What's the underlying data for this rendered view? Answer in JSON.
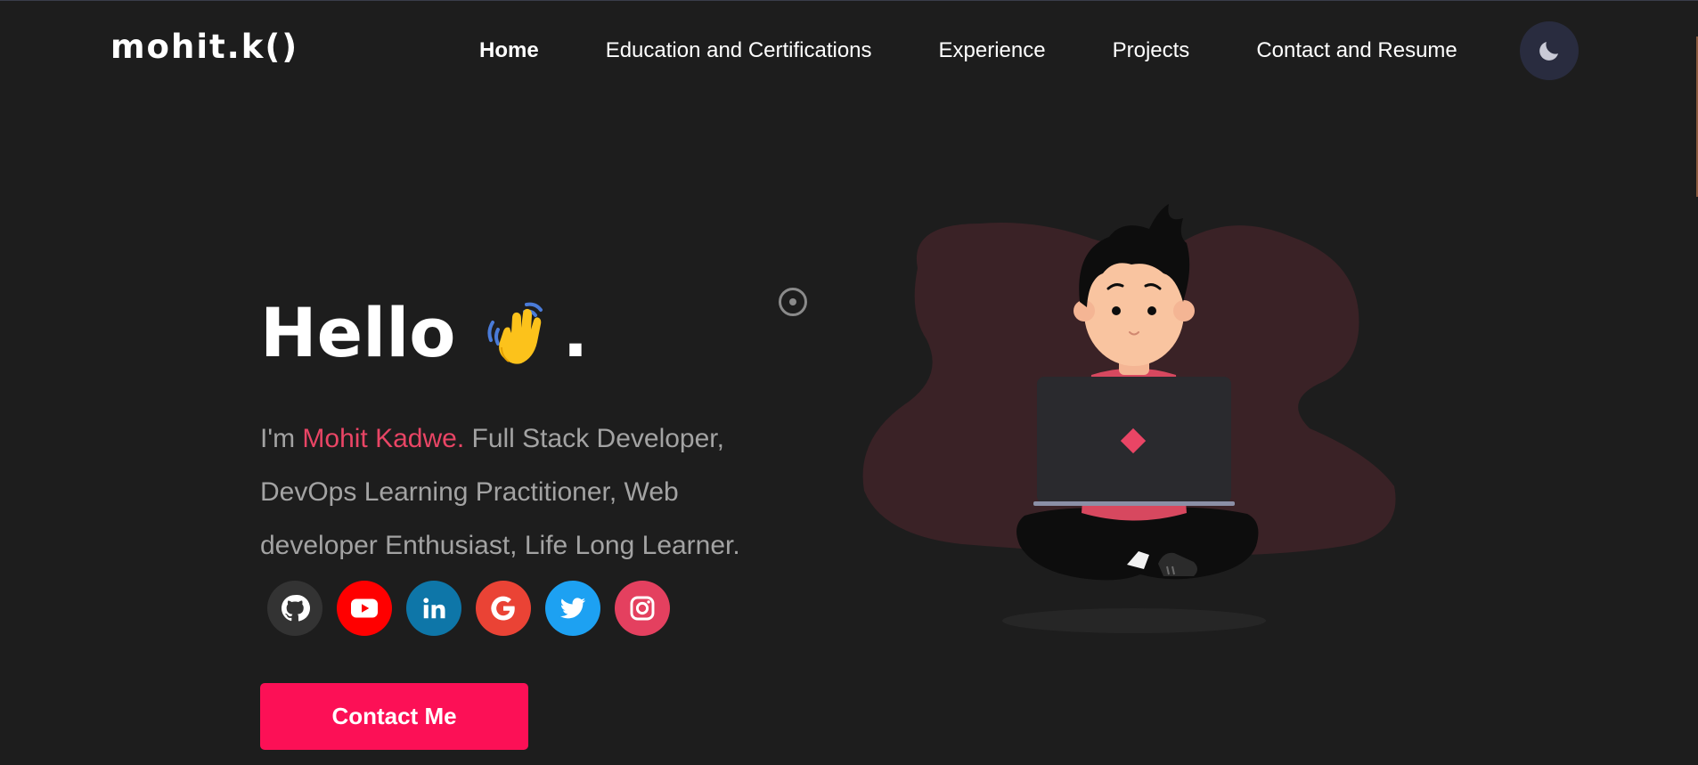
{
  "header": {
    "logo": "mohit.k()",
    "nav": [
      {
        "label": "Home",
        "active": true
      },
      {
        "label": "Education and Certifications",
        "active": false
      },
      {
        "label": "Experience",
        "active": false
      },
      {
        "label": "Projects",
        "active": false
      },
      {
        "label": "Contact and Resume",
        "active": false
      }
    ],
    "theme_toggle_icon": "moon-icon"
  },
  "hero": {
    "greeting": "Hello",
    "greeting_emoji": "waving-hand-icon",
    "greeting_end": ".",
    "intro_prefix": "I'm ",
    "intro_name": "Mohit Kadwe.",
    "intro_rest": " Full Stack Developer, DevOps Learning Practitioner, Web developer Enthusiast, Life Long Learner.",
    "socials": [
      {
        "name": "github",
        "icon": "github-icon",
        "color": "#333333"
      },
      {
        "name": "youtube",
        "icon": "youtube-icon",
        "color": "#ff0000"
      },
      {
        "name": "linkedin",
        "icon": "linkedin-icon",
        "color": "#0e76a8"
      },
      {
        "name": "google",
        "icon": "google-icon",
        "color": "#ea4335"
      },
      {
        "name": "twitter",
        "icon": "twitter-icon",
        "color": "#1da1f2"
      },
      {
        "name": "instagram",
        "icon": "instagram-icon",
        "color": "#e4405f"
      }
    ],
    "contact_button": "Contact Me"
  },
  "colors": {
    "background": "#1d1d1d",
    "accent": "#e94565",
    "button": "#fc1056",
    "text_muted": "#a3a3a3",
    "toggle_bg": "#292c3f",
    "blob": "#3a2226"
  }
}
